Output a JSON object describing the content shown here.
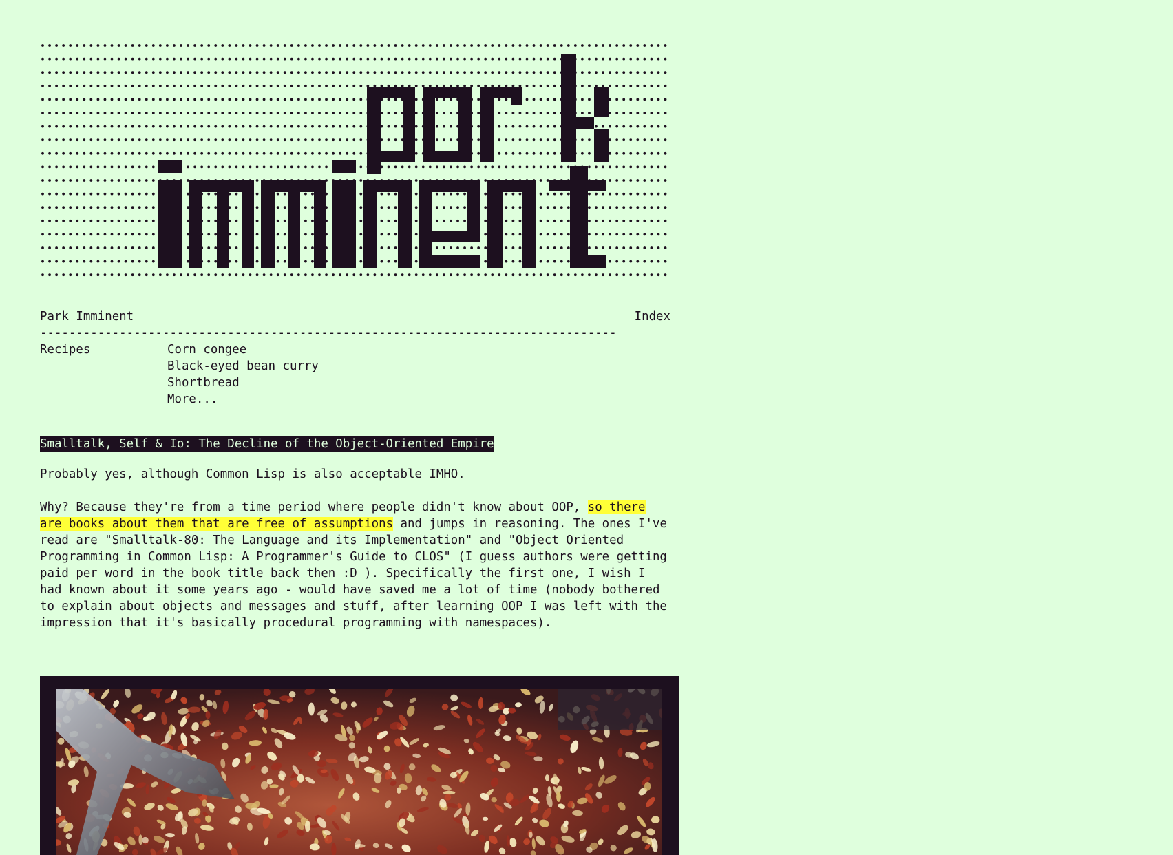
{
  "logo": {
    "line1": "park",
    "line2": "imminent",
    "colors": {
      "ink": "#1d101f",
      "background": "#dfffdd"
    }
  },
  "header": {
    "site_name": "Park Imminent",
    "index_label": "Index",
    "rule": "--------------------------------------------------------------------------------"
  },
  "recipes": {
    "label": "Recipes",
    "items": [
      "Corn congee",
      "Black-eyed bean curry",
      "Shortbread",
      "More..."
    ]
  },
  "post": {
    "title": "Smalltalk, Self & Io: The Decline of the Object-Oriented Empire",
    "para1": "Probably yes, although Common Lisp is also acceptable IMHO.",
    "para2_before": "Why? Because they're from a time period where people didn't know about OOP, ",
    "para2_highlight": "so there are books about them that are free of assumptions",
    "para2_after": " and jumps in reasoning. The ones I've read are \"Smalltalk-80: The Language and its Implementation\" and \"Object Oriented Programming in Common Lisp: A Programmer's Guide to CLOS\" (I guess authors were getting paid per word in the book title back then :D ). Specifically the first one, I wish I had known about it some years ago - would have saved me a lot of time (nobody bothered to explain about objects and messages and stuff, after learning OOP I was left with the impression that it's basically procedural programming with namespaces)."
  },
  "colors": {
    "background": "#dfffdd",
    "ink": "#1d101f",
    "highlight": "#ffff37"
  }
}
